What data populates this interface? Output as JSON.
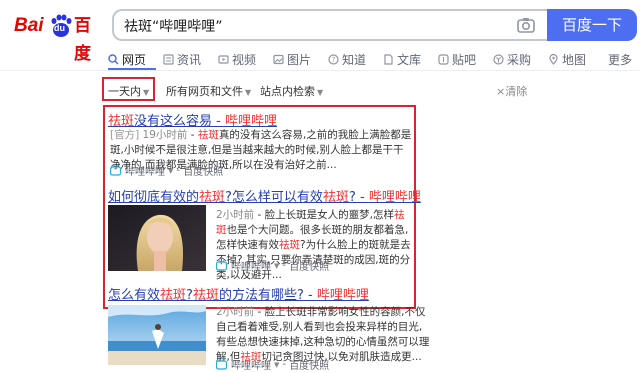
{
  "logo": {
    "latin": "Bai",
    "du": "du",
    "chinese": "百度"
  },
  "search": {
    "query": "祛斑“哔哩哔哩”",
    "button_label": "百度一下"
  },
  "tabs": [
    {
      "label": "网页",
      "icon": "search-icon"
    },
    {
      "label": "资讯",
      "icon": "news-icon"
    },
    {
      "label": "视频",
      "icon": "video-icon"
    },
    {
      "label": "图片",
      "icon": "image-icon"
    },
    {
      "label": "知道",
      "icon": "question-icon"
    },
    {
      "label": "文库",
      "icon": "doc-icon"
    },
    {
      "label": "贴吧",
      "icon": "tieba-icon"
    },
    {
      "label": "采购",
      "icon": "purchase-icon"
    },
    {
      "label": "地图",
      "icon": "map-icon"
    },
    {
      "label": "更多",
      "icon": ""
    }
  ],
  "filters": {
    "time": "一天内",
    "scope": "所有网页和文件",
    "site": "站点内检索",
    "clear": "清除"
  },
  "results": [
    {
      "title_hl": "祛斑",
      "title_rest": "没有这么容易",
      "title_sep": " - ",
      "title_site": "哔哩哔哩",
      "official": "[官方]",
      "time": "19小时前",
      "dash": " - ",
      "snippet_hl1": "祛斑",
      "snippet_a": "真的没有这么容易,之前的我脸上满脸都是斑,小时候不是很注意,但是当越来越大的时候,别人脸上都是干干净净的,而我都是满脸的斑,所以在没有治好之前...",
      "source": "哔哩哔哩",
      "snapshot": "百度快照"
    },
    {
      "title_a": "如何彻底有效的",
      "title_hl1": "祛斑",
      "title_b": "?怎么样可以有效",
      "title_hl2": "祛斑",
      "title_c": "? - ",
      "title_site": "哔哩哔哩",
      "time": "2小时前",
      "snippet_a": " - 脸上长斑是女人的噩梦,怎样",
      "snippet_hl1": "祛斑",
      "snippet_b": "也是个大问题。很多长斑的朋友都着急,怎样快速有效",
      "snippet_hl2": "祛斑",
      "snippet_c": "?为什么脸上的斑就是去不掉? 其实,只要你弄清楚斑的成因,斑的分类,以及避开...",
      "source": "哔哩哔哩",
      "snapshot": "百度快照"
    },
    {
      "title_a": "怎么有效",
      "title_hl1": "祛斑",
      "title_b": "?",
      "title_hl2": "祛斑",
      "title_c": "的方法有哪些? - ",
      "title_site": "哔哩哔哩",
      "time": "2小时前",
      "snippet_a": " - 脸上长斑非常影响女性的容颜,不仅自己看着难受,别人看到也会投来异样的目光,有些总想快速抹掉,这种急切的心情虽然可以理解,但",
      "snippet_hl1": "祛斑",
      "snippet_b": "切记贪图过快,以免对肌肤造成更...",
      "source": "哔哩哔哩",
      "snapshot": "百度快照"
    }
  ],
  "colors": {
    "brand_red": "#e10602",
    "brand_blue": "#4e6ef2",
    "link": "#2440b3",
    "highlight": "#f73131",
    "annotation_box": "#d6262c"
  }
}
